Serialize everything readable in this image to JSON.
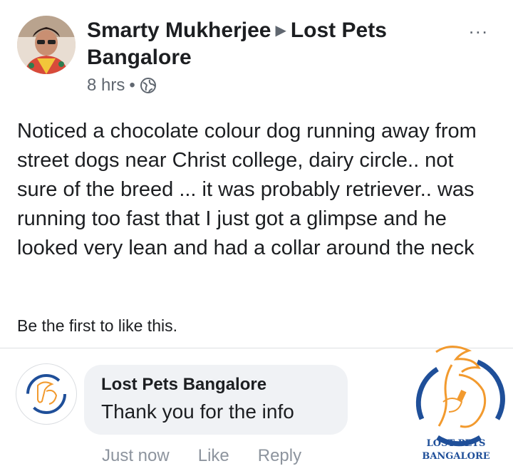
{
  "post": {
    "author": "Smarty Mukherjee",
    "group": "Lost Pets",
    "group_line2": "Bangalore",
    "time": "8 hrs",
    "dot": "•",
    "privacy_icon": "globe-icon",
    "more": "...",
    "body": "Noticed a chocolate colour dog running away from street dogs near Christ college, dairy circle.. not sure of the breed ... it was probably retriever.. was running too fast that I just got a glimpse and he looked very lean and had a collar around the neck",
    "likes_text": "Be the first to like this."
  },
  "comment": {
    "author": "Lost Pets Bangalore",
    "text": "Thank you for the info",
    "time": "Just now",
    "like_label": "Like",
    "reply_label": "Reply"
  },
  "watermark": {
    "line1": "LOST PETS",
    "line2": "BANGALORE"
  },
  "colors": {
    "logo_blue": "#1f4f99",
    "logo_orange": "#f29a2e",
    "meta_gray": "#606770",
    "bubble_bg": "#f0f2f5"
  }
}
